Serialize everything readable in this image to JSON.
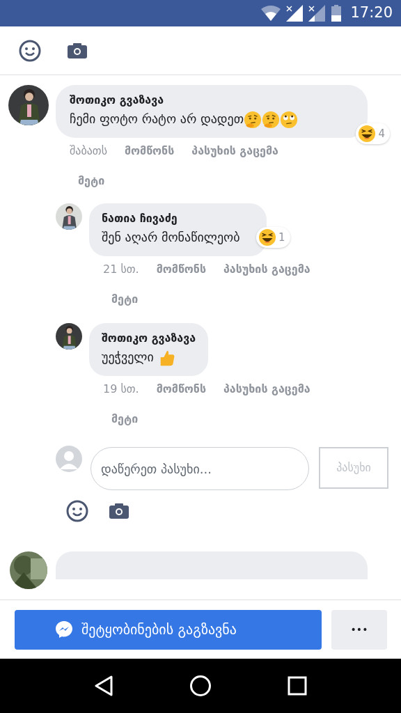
{
  "status_bar": {
    "time": "17:20"
  },
  "comments": [
    {
      "author": "შოთიკო გვაზავა",
      "text": "ჩემი ფოტო რატო არ დადეთ",
      "emojis": [
        {
          "kind": "thinking"
        },
        {
          "kind": "thinking"
        },
        {
          "kind": "eye-roll"
        }
      ],
      "reaction": {
        "kind": "laugh",
        "count": "4"
      },
      "time": "შაბათს",
      "like": "მომწონს",
      "reply": "პასუხის გაცემა",
      "more": "მეტი",
      "children": [
        {
          "author": "ნათია ჩივაძე",
          "text": "შენ აღარ მონაწილეობ",
          "reaction": {
            "kind": "laugh",
            "count": "1"
          },
          "time": "21 სთ.",
          "like": "მომწონს",
          "reply": "პასუხის გაცემა",
          "more": "მეტი"
        },
        {
          "author": "შოთიკო გვაზავა",
          "text": "უეჭველი",
          "emojis": [
            {
              "kind": "thumbs-up"
            }
          ],
          "time": "19 სთ.",
          "like": "მომწონს",
          "reply": "პასუხის გაცემა",
          "more": "მეტი"
        }
      ]
    }
  ],
  "reply_box": {
    "placeholder": "დაწერეთ პასუხი...",
    "button": "პასუხი"
  },
  "footer": {
    "message_button": "შეტყობინების გაგზავნა",
    "more_button": "•••"
  }
}
